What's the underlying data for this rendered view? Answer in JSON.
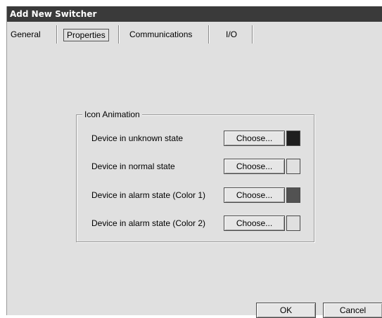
{
  "window": {
    "title": "Add New Switcher"
  },
  "tabs": [
    {
      "label": "General"
    },
    {
      "label": "Properties",
      "active": true
    },
    {
      "label": "Communications"
    },
    {
      "label": "I/O"
    }
  ],
  "icon_animation": {
    "title": "Icon Animation",
    "rows": [
      {
        "label": "Device in unknown state",
        "button": "Choose...",
        "color": "#1e1e1e"
      },
      {
        "label": "Device in normal state",
        "button": "Choose...",
        "color": "#e0e0e0"
      },
      {
        "label": "Device in alarm state (Color 1)",
        "button": "Choose...",
        "color": "#525252"
      },
      {
        "label": "Device in alarm state (Color 2)",
        "button": "Choose...",
        "color": "#e0e0e0"
      }
    ]
  },
  "buttons": {
    "ok": "OK",
    "cancel": "Cancel"
  }
}
